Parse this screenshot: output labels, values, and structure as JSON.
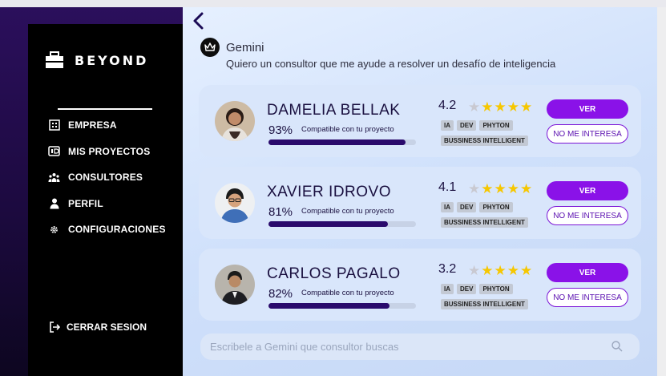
{
  "brand": {
    "name": "BEYOND"
  },
  "sidebar": {
    "items": [
      {
        "label": "EMPRESA",
        "icon": "building-icon"
      },
      {
        "label": "MIS PROYECTOS",
        "icon": "id-card-icon"
      },
      {
        "label": "CONSULTORES",
        "icon": "people-icon"
      },
      {
        "label": "PERFIL",
        "icon": "user-icon"
      },
      {
        "label": "CONFIGURACIONES",
        "icon": "gear-icon"
      }
    ],
    "logout_label": "CERRAR SESION"
  },
  "assistant": {
    "name": "Gemini",
    "message": "Quiero un consultor que me ayude a resolver un desafío de inteligencia"
  },
  "consultants": [
    {
      "name": "DAMELIA BELLAK",
      "match_pct": "93%",
      "match_value": 93,
      "compat_label": "Compatible con tu proyecto",
      "rating": "4.2",
      "stars_on": 4,
      "tags": [
        "IA",
        "DEV",
        "PHYTON",
        "BUSSINESS INTELLIGENT"
      ],
      "ver_label": "VER",
      "reject_label": "NO ME INTERESA"
    },
    {
      "name": "XAVIER IDROVO",
      "match_pct": "81%",
      "match_value": 81,
      "compat_label": "Compatible con tu proyecto",
      "rating": "4.1",
      "stars_on": 4,
      "tags": [
        "IA",
        "DEV",
        "PHYTON",
        "BUSSINESS INTELLIGENT"
      ],
      "ver_label": "VER",
      "reject_label": "NO ME INTERESA"
    },
    {
      "name": "CARLOS PAGALO",
      "match_pct": "82%",
      "match_value": 82,
      "compat_label": "Compatible con tu proyecto",
      "rating": "3.2",
      "stars_on": 4,
      "tags": [
        "IA",
        "DEV",
        "PHYTON",
        "BUSSINESS INTELLIGENT"
      ],
      "ver_label": "VER",
      "reject_label": "NO ME INTERESA"
    }
  ],
  "search": {
    "placeholder": "Escribele a Gemini que consultor buscas"
  },
  "colors": {
    "accent": "#8a12e8",
    "sidebar_bg": "#000000",
    "bar": "#2a0a6c",
    "star": "#f6c700"
  }
}
